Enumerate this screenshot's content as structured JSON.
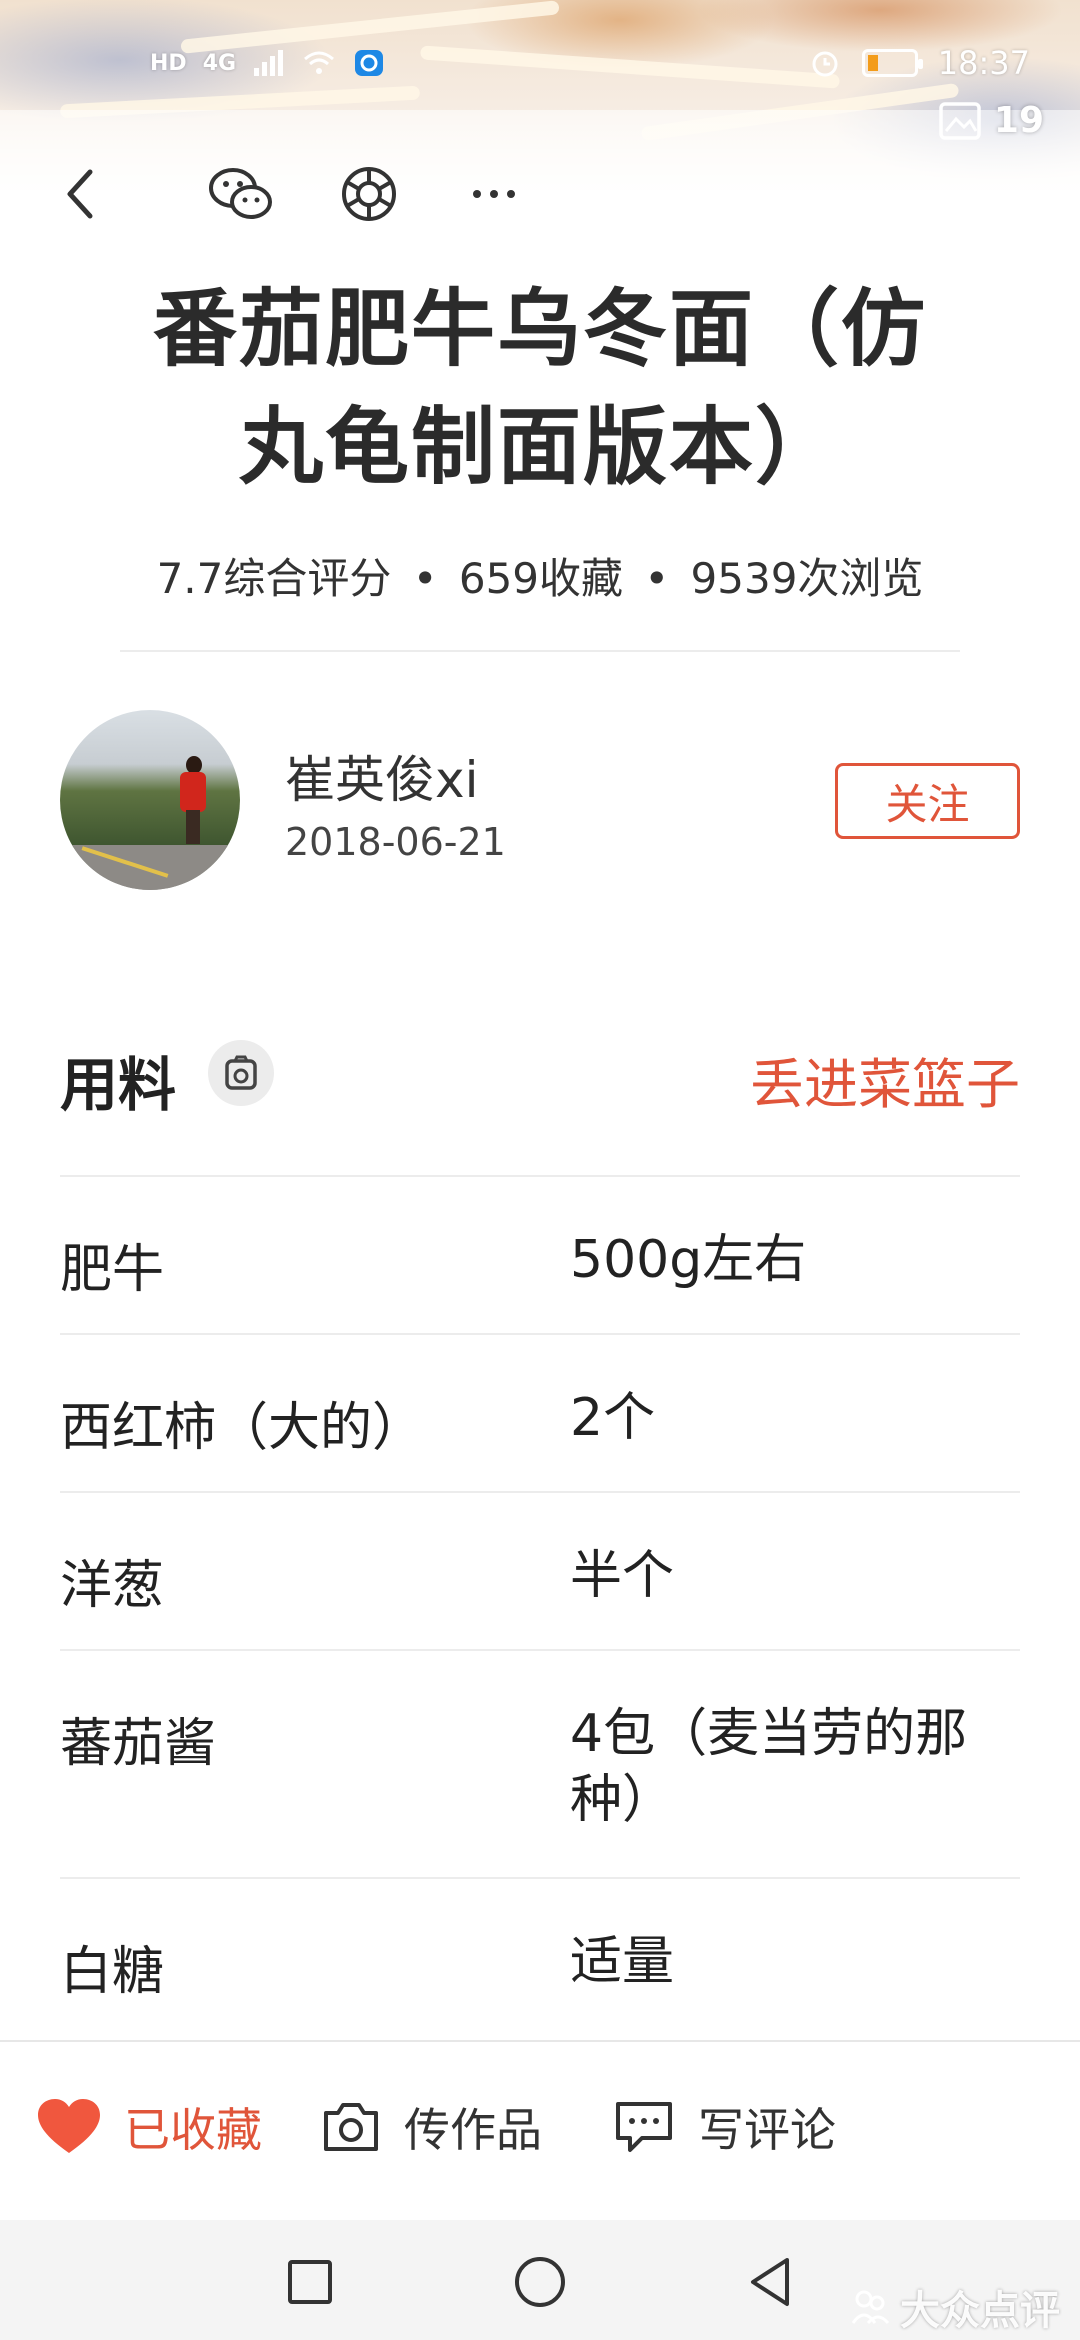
{
  "status_bar": {
    "network_labels": [
      "HD",
      "4G"
    ],
    "time": "18:37"
  },
  "gallery": {
    "count": "19"
  },
  "toolbar": {
    "icons": [
      "back-icon",
      "wechat-icon",
      "moments-icon",
      "more-icon"
    ]
  },
  "recipe": {
    "title": "番茄肥牛乌冬面（仿丸龟制面版本）",
    "stats": {
      "rating": "7.7综合评分",
      "favorites": "659收藏",
      "views": "9539次浏览",
      "separator": "•"
    }
  },
  "author": {
    "name": "崔英俊xi",
    "date": "2018-06-21",
    "follow_label": "关注"
  },
  "ingredients": {
    "title": "用料",
    "basket_label": "丢进菜篮子",
    "items": [
      {
        "name": "肥牛",
        "amount": "500g左右"
      },
      {
        "name": "西红柿（大的）",
        "amount": "2个"
      },
      {
        "name": "洋葱",
        "amount": "半个"
      },
      {
        "name": "蕃茄酱",
        "amount": "4包（麦当劳的那种）"
      },
      {
        "name": "白糖",
        "amount": "适量"
      }
    ]
  },
  "actions": {
    "favorited_label": "已收藏",
    "upload_label": "传作品",
    "comment_label": "写评论"
  },
  "colors": {
    "accent": "#e0553a",
    "heart": "#f0573e",
    "divider": "#ececec"
  },
  "watermark": "大众点评"
}
